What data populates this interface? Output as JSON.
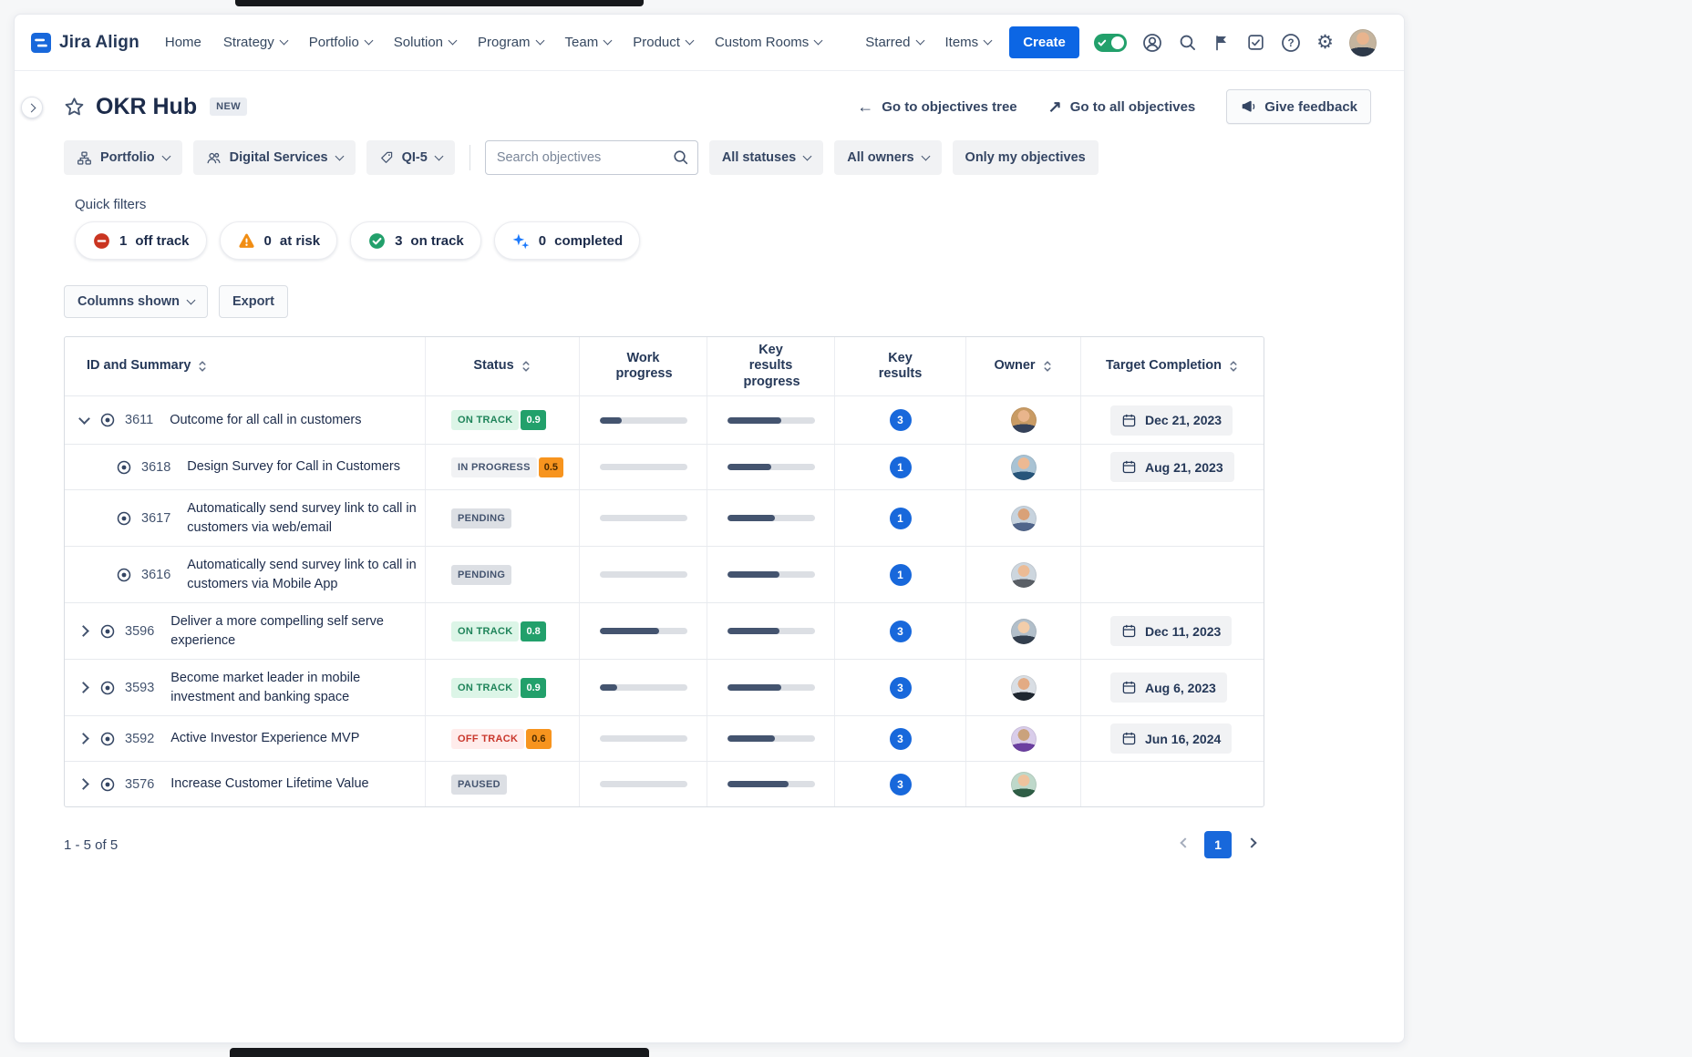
{
  "nav": {
    "brand": "Jira Align",
    "items": [
      {
        "label": "Home"
      },
      {
        "label": "Strategy"
      },
      {
        "label": "Portfolio"
      },
      {
        "label": "Solution"
      },
      {
        "label": "Program"
      },
      {
        "label": "Team"
      },
      {
        "label": "Product"
      },
      {
        "label": "Custom Rooms"
      },
      {
        "label": "Starred"
      },
      {
        "label": "Items"
      }
    ],
    "create_label": "Create"
  },
  "header": {
    "title": "OKR Hub",
    "badge": "NEW",
    "go_tree": "Go to objectives tree",
    "go_all": "Go to all objectives",
    "feedback": "Give feedback"
  },
  "filters": {
    "portfolio": "Portfolio",
    "team": "Digital Services",
    "period": "QI-5",
    "search_placeholder": "Search objectives",
    "statuses": "All statuses",
    "owners": "All owners",
    "only_mine": "Only my objectives"
  },
  "quick_filters": {
    "label": "Quick filters",
    "items": [
      {
        "count": "1",
        "label": "off track"
      },
      {
        "count": "0",
        "label": "at risk"
      },
      {
        "count": "3",
        "label": "on track"
      },
      {
        "count": "0",
        "label": "completed"
      }
    ]
  },
  "controls": {
    "columns_shown": "Columns shown",
    "export": "Export"
  },
  "table": {
    "columns": [
      "ID and Summary",
      "Status",
      "Work progress",
      "Key results progress",
      "Key results",
      "Owner",
      "Target Completion"
    ],
    "rows": [
      {
        "id": "3611",
        "summary": "Outcome for all call in customers",
        "status": "ON TRACK",
        "score": "0.9",
        "work_progress": "25%",
        "kr_progress": "62%",
        "key_results": "3",
        "target": "Dec 21, 2023"
      },
      {
        "id": "3618",
        "summary": "Design Survey for Call in Customers",
        "status": "IN PROGRESS",
        "score": "0.5",
        "work_progress": "0%",
        "kr_progress": "50%",
        "key_results": "1",
        "target": "Aug 21, 2023"
      },
      {
        "id": "3617",
        "summary": "Automatically send survey link to call in customers via web/email",
        "status": "PENDING",
        "score": "",
        "work_progress": "0%",
        "kr_progress": "55%",
        "key_results": "1",
        "target": ""
      },
      {
        "id": "3616",
        "summary": "Automatically send survey link to call in customers via Mobile App",
        "status": "PENDING",
        "score": "",
        "work_progress": "0%",
        "kr_progress": "60%",
        "key_results": "1",
        "target": ""
      },
      {
        "id": "3596",
        "summary": "Deliver a more compelling self serve experience",
        "status": "ON TRACK",
        "score": "0.8",
        "work_progress": "68%",
        "kr_progress": "60%",
        "key_results": "3",
        "target": "Dec 11, 2023"
      },
      {
        "id": "3593",
        "summary": "Become market leader in mobile investment and banking space",
        "status": "ON TRACK",
        "score": "0.9",
        "work_progress": "20%",
        "kr_progress": "62%",
        "key_results": "3",
        "target": "Aug 6, 2023"
      },
      {
        "id": "3592",
        "summary": "Active Investor Experience MVP",
        "status": "OFF TRACK",
        "score": "0.6",
        "work_progress": "0%",
        "kr_progress": "55%",
        "key_results": "3",
        "target": "Jun 16, 2024"
      },
      {
        "id": "3576",
        "summary": "Increase Customer Lifetime Value",
        "status": "PAUSED",
        "score": "",
        "work_progress": "0%",
        "kr_progress": "70%",
        "key_results": "3",
        "target": ""
      }
    ]
  },
  "footer": {
    "result_count": "1 - 5 of 5",
    "page": "1"
  },
  "colors": {
    "brand_blue": "#0C66E4",
    "on_track_green": "#22A06B",
    "off_track_red": "#C9372C",
    "score_orange": "#F7941E",
    "key_result_blue": "#1868DB"
  }
}
